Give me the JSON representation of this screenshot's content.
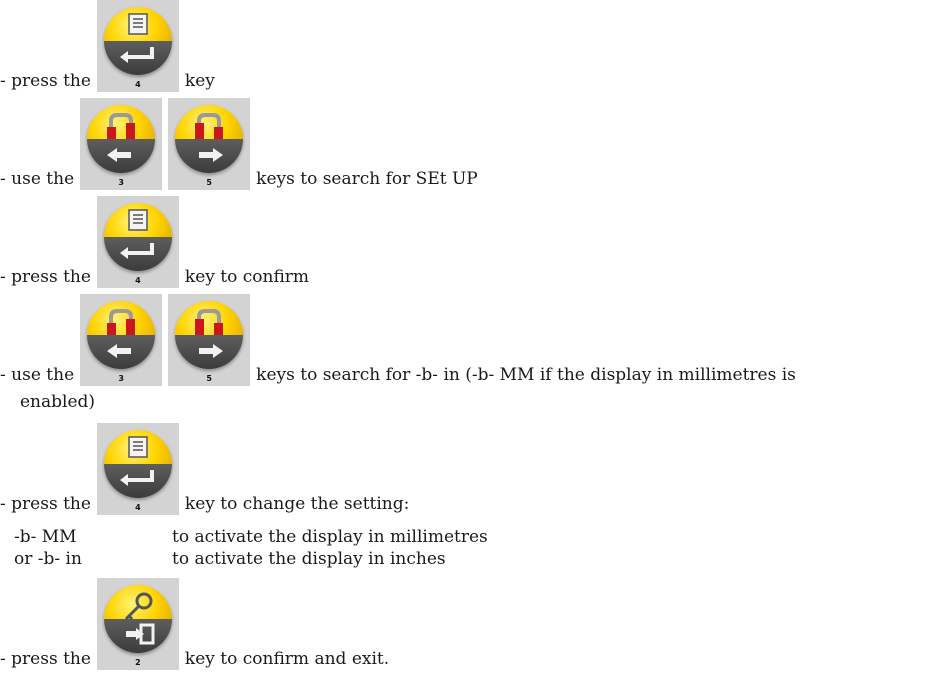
{
  "steps": [
    {
      "prefix": "- press the",
      "keys": [
        {
          "icon": "enter-key-icon",
          "number": "4"
        }
      ],
      "suffix": "key"
    },
    {
      "prefix": "- use the",
      "keys": [
        {
          "icon": "left-arrow-key-icon",
          "number": "3"
        },
        {
          "icon": "right-arrow-key-icon",
          "number": "5"
        }
      ],
      "suffix": "keys to search for SEt UP"
    },
    {
      "prefix": "- press the",
      "keys": [
        {
          "icon": "enter-key-icon",
          "number": "4"
        }
      ],
      "suffix": "key to confirm"
    },
    {
      "prefix": "- use the",
      "keys": [
        {
          "icon": "left-arrow-key-icon",
          "number": "3"
        },
        {
          "icon": "right-arrow-key-icon",
          "number": "5"
        }
      ],
      "suffix": "keys to search for -b- in (-b- MM if the display in millimetres is",
      "continuation": "enabled)"
    },
    {
      "prefix": "- press the",
      "keys": [
        {
          "icon": "enter-key-icon",
          "number": "4"
        }
      ],
      "suffix": "key to change the setting:"
    },
    {
      "prefix": "- press the",
      "keys": [
        {
          "icon": "exit-key-icon",
          "number": "2"
        }
      ],
      "suffix": "key to confirm and exit."
    }
  ],
  "settings": [
    {
      "option": "-b- MM",
      "description": "to activate the display in millimetres"
    },
    {
      "option": "or -b- in",
      "description": "to activate the display in inches"
    }
  ],
  "colors": {
    "key_background": "#d3d3d3",
    "key_yellow": "#ffd400",
    "key_dark": "#4a4a4a",
    "key_red": "#d01a1a"
  }
}
